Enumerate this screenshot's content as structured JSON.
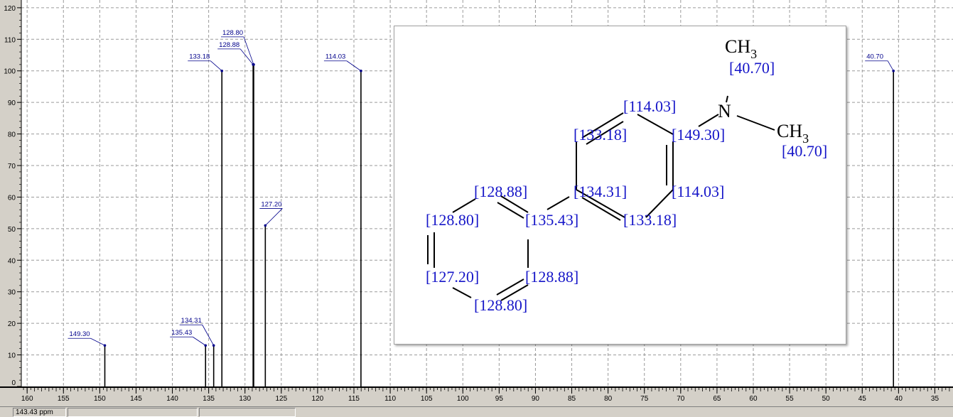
{
  "chart_data": {
    "type": "nmr_spectrum",
    "xlim": [
      160.8,
      32.5
    ],
    "ylim": [
      0,
      122
    ],
    "x_ticks": [
      160,
      155,
      150,
      145,
      140,
      135,
      130,
      125,
      120,
      115,
      110,
      105,
      100,
      95,
      90,
      85,
      80,
      75,
      70,
      65,
      60,
      55,
      50,
      45,
      40,
      35
    ],
    "y_ticks": [
      0,
      10,
      20,
      30,
      40,
      50,
      60,
      70,
      80,
      90,
      100,
      110,
      120
    ],
    "grid": true,
    "peaks": [
      {
        "x": 149.3,
        "y": 13,
        "label": "149.30"
      },
      {
        "x": 135.43,
        "y": 13,
        "label": "135.43"
      },
      {
        "x": 134.31,
        "y": 13,
        "label": "134.31"
      },
      {
        "x": 133.18,
        "y": 100,
        "label": "133.18"
      },
      {
        "x": 128.88,
        "y": 102,
        "label": "128.88"
      },
      {
        "x": 128.8,
        "y": 102,
        "label": "128.80"
      },
      {
        "x": 127.2,
        "y": 51,
        "label": "127.20"
      },
      {
        "x": 114.03,
        "y": 100,
        "label": "114.03"
      },
      {
        "x": 40.7,
        "y": 100,
        "label": "40.70"
      }
    ]
  },
  "statusbar": {
    "cursor_position": "143.43 ppm"
  },
  "structure": {
    "atoms": [
      {
        "id": "n",
        "text": "N"
      },
      {
        "id": "ch3_top",
        "text": "CH",
        "sub": "3"
      },
      {
        "id": "ch3_right",
        "text": "CH",
        "sub": "3"
      }
    ],
    "shift_labels": [
      {
        "id": "me_top",
        "text": "[40.70]"
      },
      {
        "id": "me_right",
        "text": "[40.70]"
      },
      {
        "id": "a_114_top",
        "text": "[114.03]"
      },
      {
        "id": "a_133_top",
        "text": "[133.18]"
      },
      {
        "id": "a_149",
        "text": "[149.30]"
      },
      {
        "id": "a_134",
        "text": "[134.31]"
      },
      {
        "id": "a_114_bottom",
        "text": "[114.03]"
      },
      {
        "id": "a_133_bottom",
        "text": "[133.18]"
      },
      {
        "id": "b_128_88_top",
        "text": "[128.88]"
      },
      {
        "id": "b_128_80_left",
        "text": "[128.80]"
      },
      {
        "id": "b_135",
        "text": "[135.43]"
      },
      {
        "id": "b_127",
        "text": "[127.20]"
      },
      {
        "id": "b_128_88_bottom",
        "text": "[128.88]"
      },
      {
        "id": "b_128_80_bottom",
        "text": "[128.80]"
      }
    ]
  }
}
